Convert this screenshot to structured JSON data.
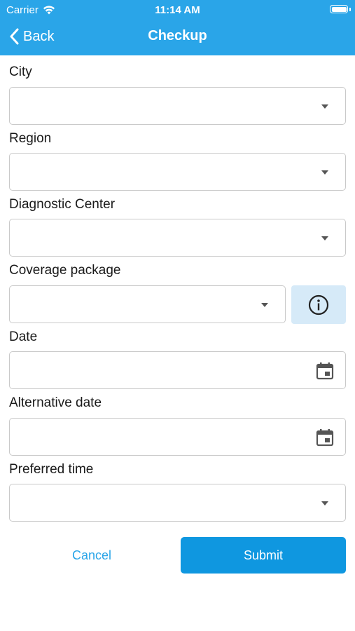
{
  "status_bar": {
    "carrier": "Carrier",
    "time": "11:14 AM"
  },
  "nav": {
    "back_label": "Back",
    "title": "Checkup"
  },
  "fields": {
    "city": {
      "label": "City",
      "value": ""
    },
    "region": {
      "label": "Region",
      "value": ""
    },
    "diagnostic_center": {
      "label": "Diagnostic Center",
      "value": ""
    },
    "coverage_package": {
      "label": "Coverage package",
      "value": ""
    },
    "date": {
      "label": "Date",
      "value": ""
    },
    "alternative_date": {
      "label": "Alternative date",
      "value": ""
    },
    "preferred_time": {
      "label": "Preferred time",
      "value": ""
    }
  },
  "actions": {
    "cancel_label": "Cancel",
    "submit_label": "Submit"
  },
  "colors": {
    "header_bg": "#2aa5e8",
    "submit_bg": "#0f97e0",
    "info_bg": "#d6eaf8",
    "link": "#2aa5e8"
  },
  "icons": {
    "back": "chevron-left-icon",
    "wifi": "wifi-icon",
    "battery": "battery-icon",
    "dropdown": "caret-down-icon",
    "calendar": "calendar-icon",
    "info": "info-circle-icon"
  }
}
